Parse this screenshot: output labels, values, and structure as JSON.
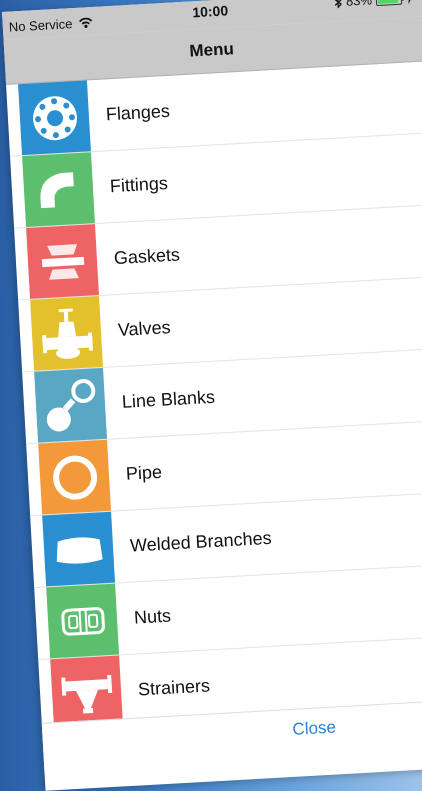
{
  "status": {
    "carrier": "No Service",
    "time": "10:00",
    "battery": "83%",
    "battery_level": 0.83,
    "icons": [
      "wifi-icon",
      "bluetooth-icon",
      "battery-icon",
      "charging-bolt-icon"
    ]
  },
  "nav": {
    "title": "Menu"
  },
  "menu": {
    "items": [
      {
        "label": "Flanges",
        "icon": "flange-icon",
        "color": "#2a8fd0"
      },
      {
        "label": "Fittings",
        "icon": "elbow-fitting-icon",
        "color": "#5bbf6d"
      },
      {
        "label": "Gaskets",
        "icon": "gasket-icon",
        "color": "#ee6464"
      },
      {
        "label": "Valves",
        "icon": "valve-icon",
        "color": "#e5c02d"
      },
      {
        "label": "Line Blanks",
        "icon": "line-blank-icon",
        "color": "#5aa7c4"
      },
      {
        "label": "Pipe",
        "icon": "pipe-icon",
        "color": "#f29a39"
      },
      {
        "label": "Welded Branches",
        "icon": "welded-branch-icon",
        "color": "#2a8fd0"
      },
      {
        "label": "Nuts",
        "icon": "nut-icon",
        "color": "#5bbf6d"
      },
      {
        "label": "Strainers",
        "icon": "strainer-icon",
        "color": "#ee6464"
      }
    ]
  },
  "footer": {
    "close_label": "Close"
  }
}
